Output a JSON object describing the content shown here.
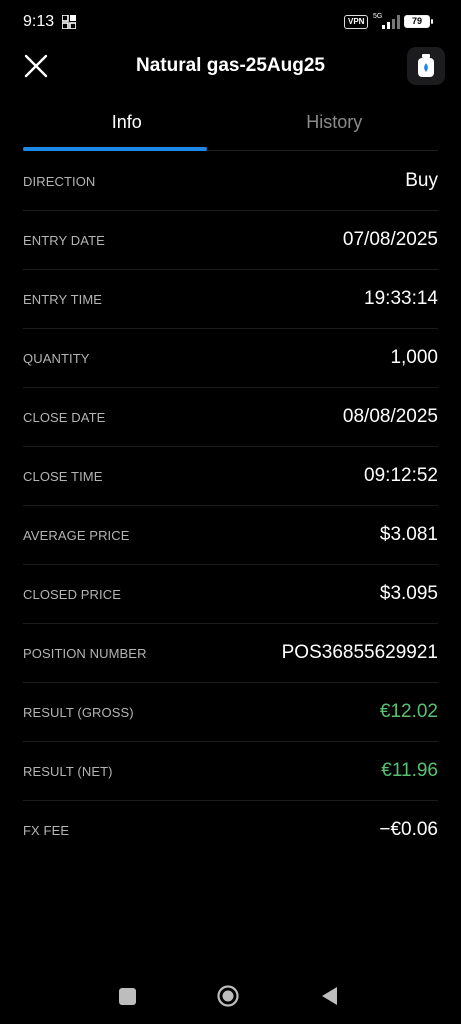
{
  "status_bar": {
    "time": "9:13",
    "vpn": "VPN",
    "network": "5G",
    "battery": "79"
  },
  "header": {
    "title": "Natural gas-25Aug25"
  },
  "tabs": [
    {
      "label": "Info",
      "active": true
    },
    {
      "label": "History",
      "active": false
    }
  ],
  "rows": [
    {
      "label": "DIRECTION",
      "value": "Buy"
    },
    {
      "label": "ENTRY DATE",
      "value": "07/08/2025"
    },
    {
      "label": "ENTRY TIME",
      "value": "19:33:14"
    },
    {
      "label": "QUANTITY",
      "value": "1,000"
    },
    {
      "label": "CLOSE DATE",
      "value": "08/08/2025"
    },
    {
      "label": "CLOSE TIME",
      "value": "09:12:52"
    },
    {
      "label": "AVERAGE PRICE",
      "value": "$3.081"
    },
    {
      "label": "CLOSED PRICE",
      "value": "$3.095"
    },
    {
      "label": "POSITION NUMBER",
      "value": "POS36855629921"
    },
    {
      "label": "RESULT (GROSS)",
      "value": "€12.02"
    },
    {
      "label": "RESULT (NET)",
      "value": "€11.96"
    },
    {
      "label": "FX FEE",
      "value": "−€0.06"
    }
  ],
  "colors": {
    "positive": "#56c271",
    "accent": "#1e88e5",
    "background": "#000000"
  },
  "icons": {
    "close": "close-icon",
    "app": "gas-bottle-icon"
  }
}
